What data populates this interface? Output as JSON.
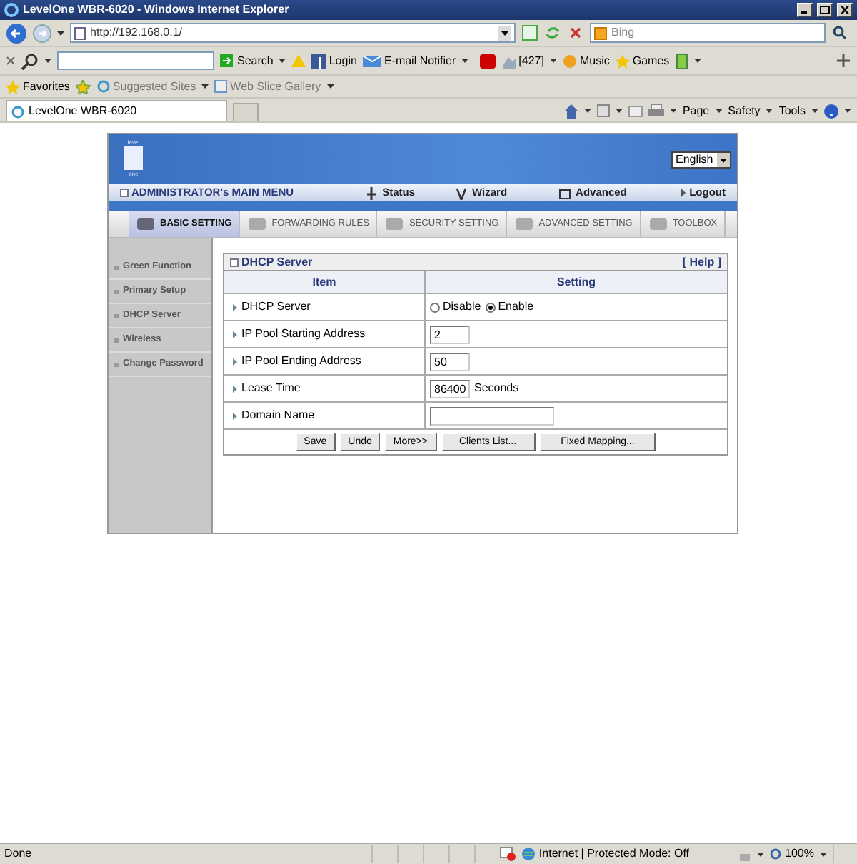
{
  "window": {
    "title": "LevelOne WBR-6020 - Windows Internet Explorer"
  },
  "address_bar": {
    "url": "http://192.168.0.1/",
    "search_placeholder": "Bing"
  },
  "toolbar": {
    "items": [
      {
        "label": "Search"
      },
      {
        "label": "Login"
      },
      {
        "label": "E-mail Notifier"
      },
      {
        "label": "[427]"
      },
      {
        "label": "Music"
      },
      {
        "label": "Games"
      }
    ]
  },
  "favorites_bar": {
    "title": "Favorites",
    "items": [
      {
        "label": "Suggested Sites"
      },
      {
        "label": "Web Slice Gallery"
      }
    ]
  },
  "browser_tab": {
    "title": "LevelOne WBR-6020"
  },
  "command_bar": {
    "items": [
      {
        "label": "Page"
      },
      {
        "label": "Safety"
      },
      {
        "label": "Tools"
      }
    ]
  },
  "router": {
    "logo": {
      "top": "level",
      "bottom": "one"
    },
    "language": "English",
    "main_menu": {
      "title": "ADMINISTRATOR's MAIN MENU",
      "items": [
        {
          "label": "Status"
        },
        {
          "label": "Wizard"
        },
        {
          "label": "Advanced"
        },
        {
          "label": "Logout"
        }
      ]
    },
    "tabs": [
      {
        "label": "BASIC SETTING",
        "selected": true
      },
      {
        "label": "FORWARDING RULES",
        "selected": false
      },
      {
        "label": "SECURITY SETTING",
        "selected": false
      },
      {
        "label": "ADVANCED SETTING",
        "selected": false
      },
      {
        "label": "TOOLBOX",
        "selected": false
      }
    ],
    "sidebar": {
      "items": [
        {
          "label": "Green Function"
        },
        {
          "label": "Primary Setup"
        },
        {
          "label": "DHCP Server"
        },
        {
          "label": "Wireless"
        },
        {
          "label": "Change Password"
        }
      ]
    },
    "panel": {
      "title": "DHCP Server",
      "help": "[ Help ]",
      "columns": [
        "Item",
        "Setting"
      ],
      "rows": [
        {
          "kind": "radio",
          "label": "DHCP Server",
          "options": [
            {
              "label": "Disable",
              "selected": false
            },
            {
              "label": "Enable",
              "selected": true
            }
          ]
        },
        {
          "kind": "number",
          "label": "IP Pool Starting Address",
          "value": "2"
        },
        {
          "kind": "number",
          "label": "IP Pool Ending Address",
          "value": "50"
        },
        {
          "kind": "number",
          "label": "Lease Time",
          "value": "86400",
          "unit": "Seconds"
        },
        {
          "kind": "text",
          "label": "Domain Name"
        }
      ],
      "buttons": [
        "Save",
        "Undo",
        "More>>",
        "Clients List...",
        "Fixed Mapping..."
      ]
    }
  },
  "status_bar": {
    "text": "Done",
    "zone": "Internet | Protected Mode: Off",
    "zoom": "100%"
  }
}
